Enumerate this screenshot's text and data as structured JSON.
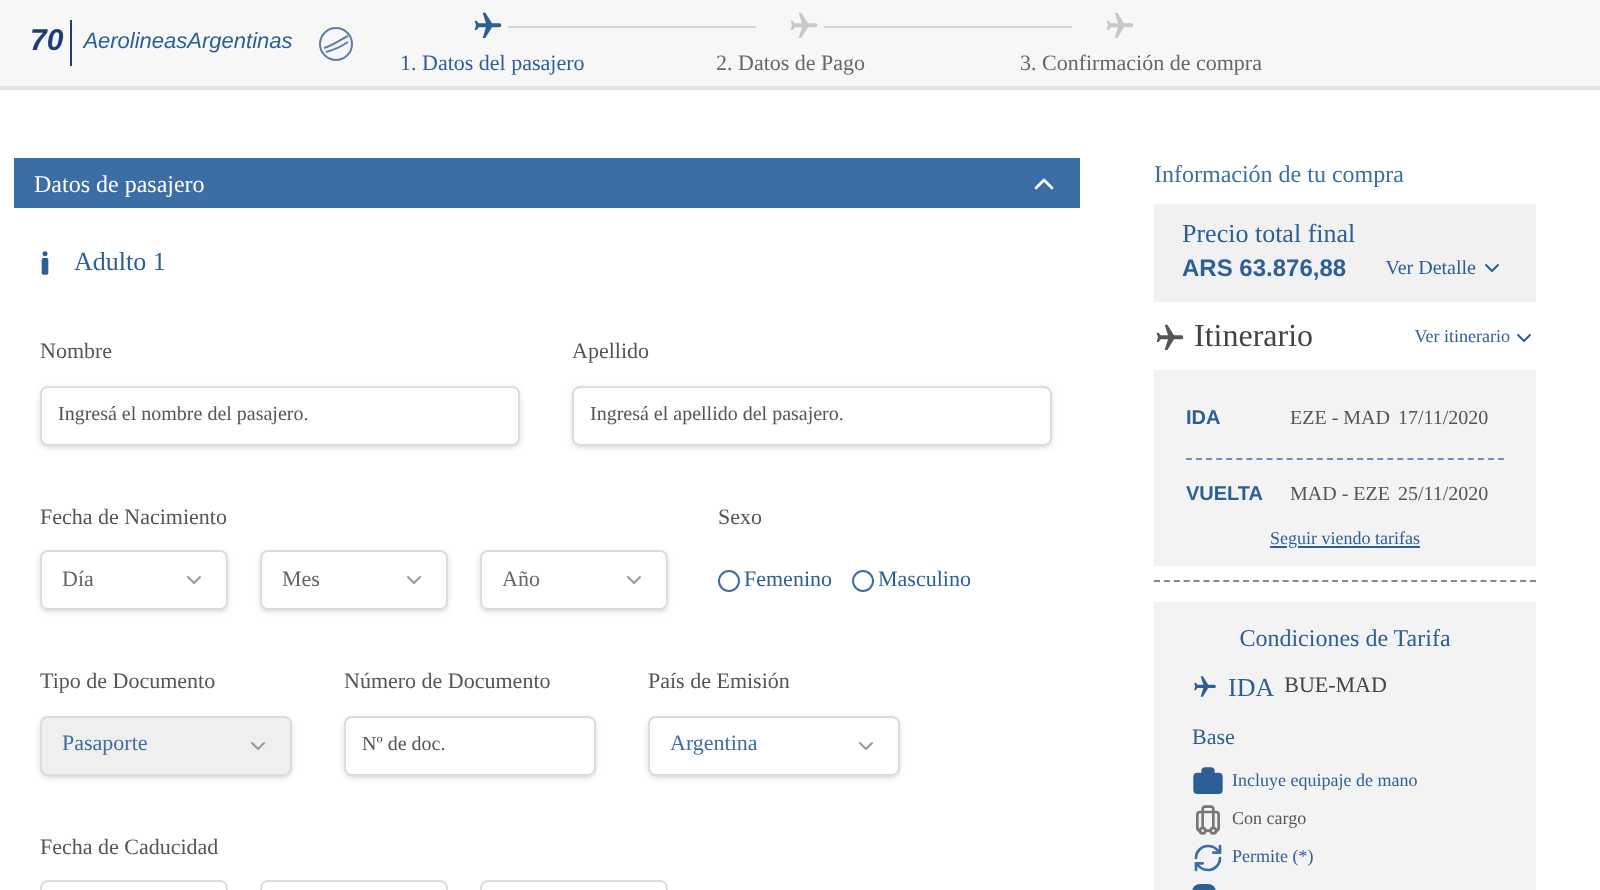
{
  "header": {
    "logo_number": "70",
    "logo_text": "AerolineasArgentinas",
    "steps": [
      {
        "label": "1. Datos del pasajero",
        "selected": true
      },
      {
        "label": "2. Datos de Pago",
        "selected": false
      },
      {
        "label": "3. Confirmación de compra",
        "selected": false
      }
    ]
  },
  "passenger_panel": {
    "title": "Datos de pasajero",
    "expanded": true,
    "passenger": "Adulto 1",
    "name_fields": [
      {
        "label": "Nombre",
        "placeholder": "Ingresá el nombre del pasajero."
      },
      {
        "label": "Apellido",
        "placeholder": "Ingresá el apellido del pasajero."
      }
    ],
    "birth_date": {
      "label": "Fecha de Nacimiento",
      "selects": [
        {
          "placeholder": "Día"
        },
        {
          "placeholder": "Mes"
        },
        {
          "placeholder": "Año"
        }
      ]
    },
    "sex": {
      "label": "Sexo",
      "options": [
        {
          "label": "Femenino",
          "selected": false
        },
        {
          "label": "Masculino",
          "selected": false
        }
      ]
    },
    "document_fields": [
      {
        "label": "Tipo de Documento",
        "kind": "select",
        "value": "Pasaporte",
        "disabled": true
      },
      {
        "label": "Número de Documento",
        "kind": "text",
        "placeholder": "Nº de doc.",
        "disabled": false
      },
      {
        "label": "País de Emisión",
        "kind": "select",
        "value": "Argentina",
        "disabled": false
      }
    ],
    "expiry_date": {
      "label": "Fecha de Caducidad"
    }
  },
  "purchase_info": {
    "title": "Información de tu compra",
    "price_label": "Precio total final",
    "price": "ARS 63.876,88",
    "detail_link": "Ver Detalle",
    "itinerary_title": "Itinerario",
    "itinerary_link": "Ver itinerario",
    "legs": [
      {
        "direction": "IDA",
        "route": "EZE - MAD",
        "date": "17/11/2020"
      },
      {
        "direction": "VUELTA",
        "route": "MAD - EZE",
        "date": "25/11/2020"
      }
    ],
    "more_fares_link": "Seguir viendo tarifas"
  },
  "fare_conditions": {
    "title": "Condiciones de Tarifa",
    "direction": "IDA",
    "route": "BUE-MAD",
    "fare": "Base",
    "items": [
      {
        "kind": "carry_on",
        "text": "Incluye equipaje de mano"
      },
      {
        "kind": "checked_bag",
        "text": "Con cargo"
      },
      {
        "kind": "change",
        "text": "Permite (*)"
      },
      {
        "kind": "other"
      }
    ]
  }
}
